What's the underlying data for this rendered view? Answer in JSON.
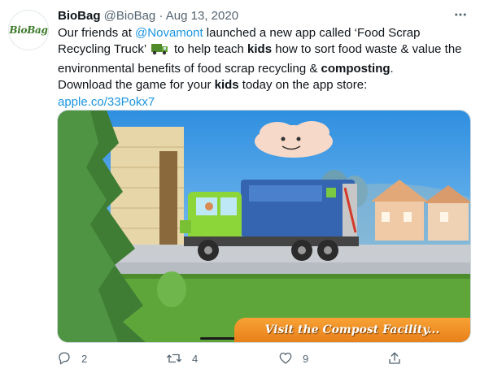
{
  "tweet": {
    "author": {
      "display_name": "BioBag",
      "handle": "@BioBag",
      "separator": "·",
      "date": "Aug 13, 2020",
      "avatar_text": "BioBag"
    },
    "body": {
      "l1_a": "Our friends at ",
      "l1_mention": "@Novamont",
      "l1_b": " launched a new app called ‘Food Scrap",
      "l2_a": "Recycling Truck’ ",
      "l2_b": " to help teach ",
      "l2_kids": "kids",
      "l2_c": " how to sort food waste & value the",
      "l3_a": "environmental benefits of food scrap recycling & ",
      "l3_composting": "composting",
      "l3_b": ".",
      "l4_a": "Download the game for your ",
      "l4_kids": "kids",
      "l4_b": " today on the app store:",
      "link": "apple.co/33Pokx7"
    },
    "media": {
      "cta_text": "Visit the Compost Facility..."
    },
    "actions": {
      "reply_count": "2",
      "retweet_count": "4",
      "like_count": "9"
    },
    "icons": {
      "more": "more-icon",
      "reply": "reply-icon",
      "retweet": "retweet-icon",
      "like": "heart-icon",
      "share": "share-icon",
      "emoji": "truck-emoji"
    },
    "colors": {
      "link": "#1b95e0",
      "text": "#0f1419",
      "muted": "#536471",
      "cta_orange": "#f39a2b"
    }
  }
}
